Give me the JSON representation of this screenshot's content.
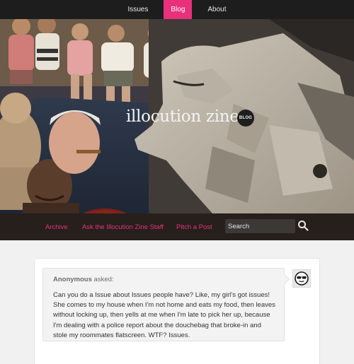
{
  "topnav": {
    "items": [
      {
        "label": "Issues",
        "active": false
      },
      {
        "label": "Blog",
        "active": true
      },
      {
        "label": "About",
        "active": false
      }
    ],
    "accent_color": "#e8317a"
  },
  "header": {
    "site_title": "illocution zine",
    "badge": "BLOG"
  },
  "subnav": {
    "links": [
      "Archive",
      "Ask the Illocution Zine Staff",
      "Pitch a Post"
    ],
    "link_color": "#e2337f",
    "search": {
      "placeholder": "Search",
      "icon": "search-icon"
    }
  },
  "post": {
    "asker_name": "Anonymous",
    "asker_verb": "asked:",
    "question_lines": [
      "Can you do a Issue about Issues people have? Like, my girl's got issues!",
      "She comes to my house when I'm not home and eats my food, then leaves",
      "without locking up, then yells at me when I'm late to pick her up, because",
      "I'm dealing with a police report about the douchebag that broke-in and",
      "stole my roommates flatscreen. WTF? Issues."
    ],
    "avatar_icon": "sunglasses-face-icon"
  }
}
